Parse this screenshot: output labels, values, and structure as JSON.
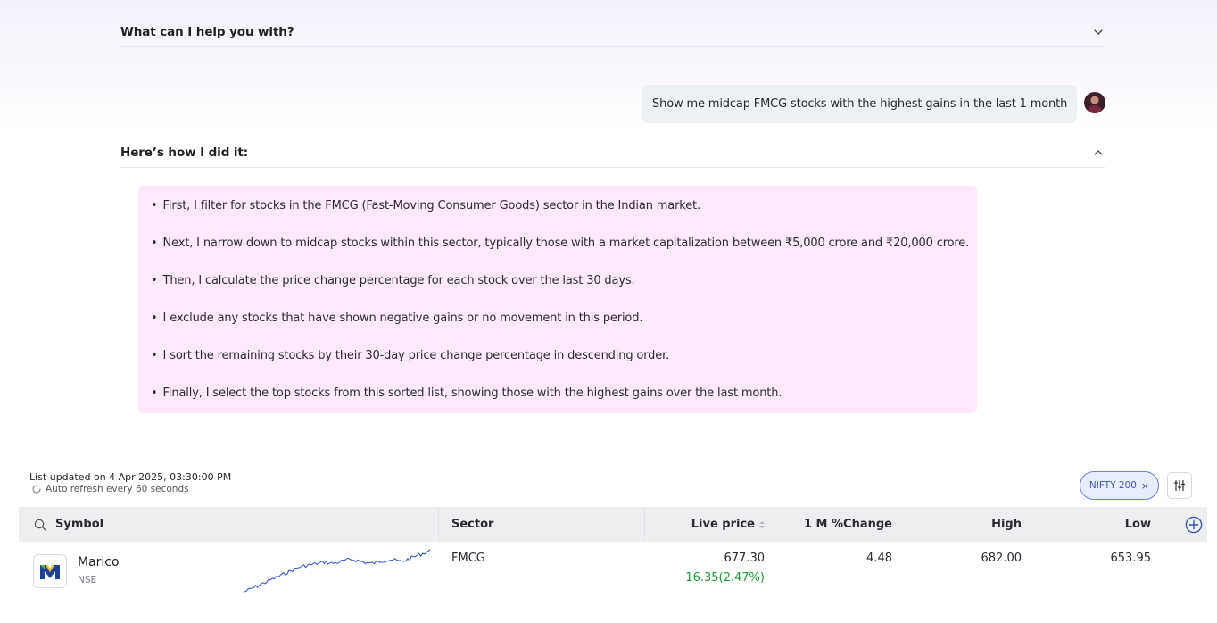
{
  "accordion_top": {
    "title": "What can I help you with?",
    "icon": "chevron-down-icon"
  },
  "user_message": {
    "text": "Show me midcap FMCG stocks with the highest gains in the last 1 month"
  },
  "accordion_method": {
    "title": "Here’s how I did it:",
    "icon": "chevron-up-icon"
  },
  "steps": [
    "First, I filter for stocks in the FMCG (Fast-Moving Consumer Goods) sector in the Indian market.",
    "Next, I narrow down to midcap stocks within this sector, typically those with a market capitalization between ₹5,000 crore and ₹20,000 crore.",
    "Then, I calculate the price change percentage for each stock over the last 30 days.",
    "I exclude any stocks that have shown negative gains or no movement in this period.",
    "I sort the remaining stocks by their 30-day price change percentage in descending order.",
    "Finally, I select the top stocks from this sorted list, showing those with the highest gains over the last month."
  ],
  "bullet": "•",
  "list_status": {
    "updated": "List updated on 4 Apr 2025, 03:30:00 PM",
    "refresh": "Auto refresh every 60 seconds"
  },
  "filter_chip": {
    "label": "NIFTY 200",
    "remove": "×"
  },
  "table": {
    "columns": {
      "symbol": "Symbol",
      "sector": "Sector",
      "live_price": "Live price",
      "change_1m": "1 M %Change",
      "high": "High",
      "low": "Low"
    },
    "rows": [
      {
        "name": "Marico",
        "exchange": "NSE",
        "sector": "FMCG",
        "live_price": "677.30",
        "day_change": "16.35(2.47%)",
        "change_1m": "4.48",
        "high": "682.00",
        "low": "653.95"
      }
    ]
  },
  "colors": {
    "accent": "#3d56b5",
    "gain": "#1e9b3a",
    "steps_bg": "#fde9fb",
    "sparkline": "#2f4fd0"
  }
}
